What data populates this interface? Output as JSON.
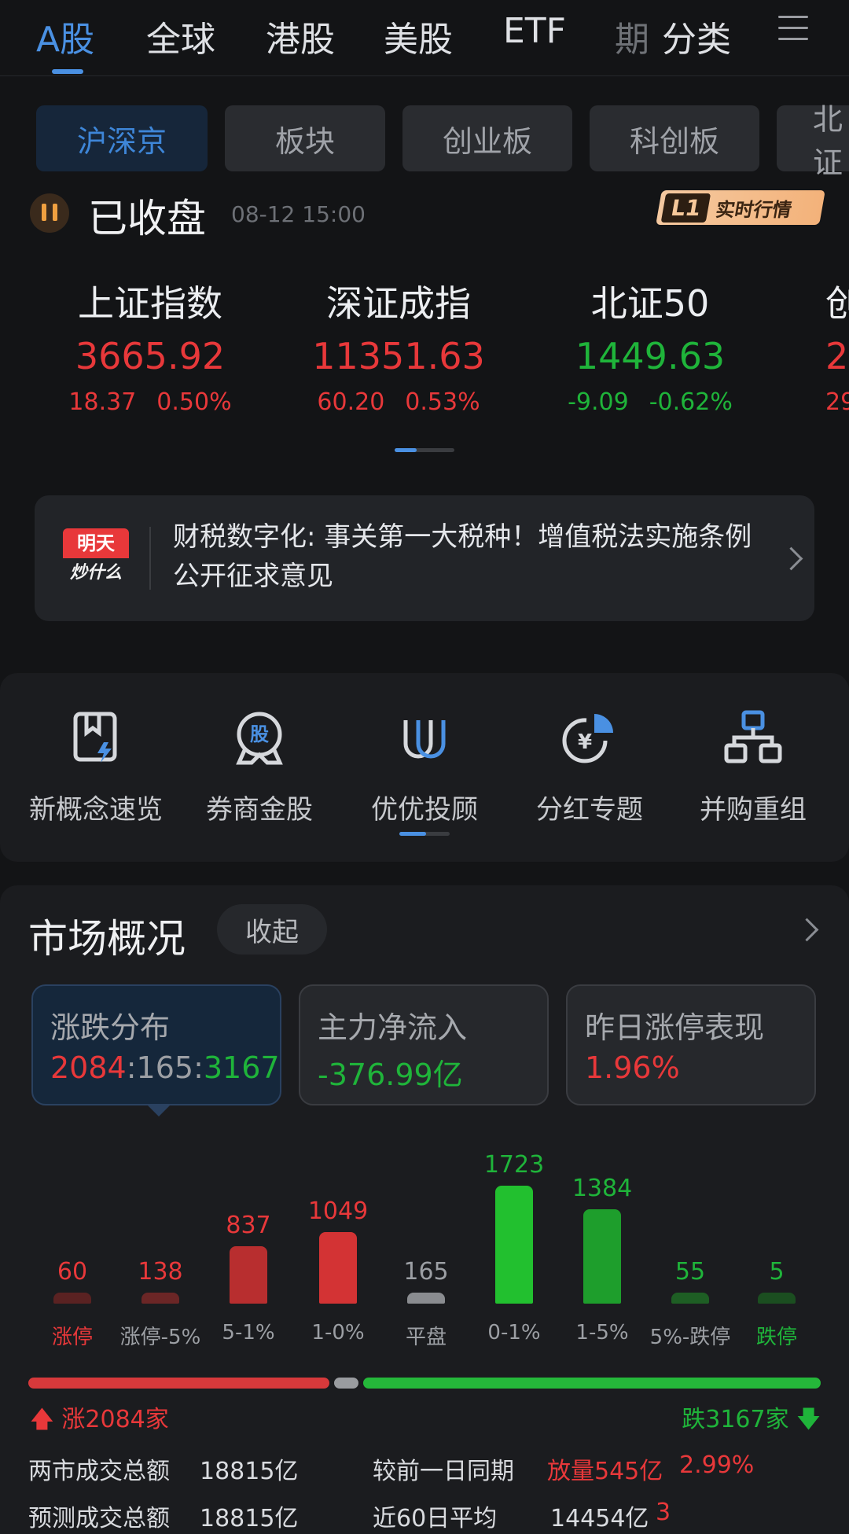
{
  "top_tabs": [
    "A股",
    "全球",
    "港股",
    "美股",
    "ETF",
    "期",
    "分类"
  ],
  "sub_tabs": [
    "沪深京",
    "板块",
    "创业板",
    "科创板",
    "北证"
  ],
  "status": {
    "title": "已收盘",
    "time": "08-12  15:00",
    "badge_l1": "L1",
    "badge_text": "实时行情"
  },
  "indices": [
    {
      "name": "上证指数",
      "value": "3665.92",
      "change": "18.37",
      "pct": "0.50%",
      "color": "#e8383a"
    },
    {
      "name": "深证成指",
      "value": "11351.63",
      "change": "60.20",
      "pct": "0.53%",
      "color": "#e8383a"
    },
    {
      "name": "北证50",
      "value": "1449.63",
      "change": "-9.09",
      "pct": "-0.62%",
      "color": "#1fb43a"
    },
    {
      "name": "创",
      "value": "2",
      "change": "29.",
      "pct": "",
      "color": "#e8383a"
    }
  ],
  "news": {
    "logo_top": "明天",
    "logo_bottom": "炒什么",
    "text": "财税数字化: 事关第一大税种！增值税法实施条例公开征求意见"
  },
  "shortcuts": [
    {
      "label": "新概念速览",
      "icon": "new-concept-icon"
    },
    {
      "label": "券商金股",
      "icon": "broker-gold-stock-icon"
    },
    {
      "label": "优优投顾",
      "icon": "advisor-icon"
    },
    {
      "label": "分红专题",
      "icon": "dividend-icon"
    },
    {
      "label": "并购重组",
      "icon": "merger-icon"
    }
  ],
  "market": {
    "title": "市场概况",
    "collapse_label": "收起",
    "cards": [
      {
        "label": "涨跌分布",
        "up": "2084",
        "flat": "165",
        "down": "3167"
      },
      {
        "label": "主力净流入",
        "value": "-376.99亿"
      },
      {
        "label": "昨日涨停表现",
        "value": "1.96%"
      }
    ],
    "up_label": "涨2084家",
    "down_label": "跌3167家",
    "up_count": 2084,
    "flat_count": 165,
    "down_count": 3167
  },
  "chart_data": {
    "type": "bar",
    "categories": [
      "涨停",
      "涨停-5%",
      "5-1%",
      "1-0%",
      "平盘",
      "0-1%",
      "1-5%",
      "5%-跌停",
      "跌停"
    ],
    "values": [
      60,
      138,
      837,
      1049,
      165,
      1723,
      1384,
      55,
      5
    ],
    "colors": [
      "#e8383a",
      "#e8383a",
      "#e8383a",
      "#e8383a",
      "#8a8c90",
      "#1fb43a",
      "#1fb43a",
      "#1fb43a",
      "#1fb43a"
    ],
    "bar_colors": [
      "#5a2222",
      "#6b2626",
      "#b82e2f",
      "#d33334",
      "#8a8c90",
      "#22c02f",
      "#1e9e2c",
      "#1e5e24",
      "#1b4e20"
    ],
    "label_colors": [
      "#e8383a",
      "#e8383a",
      "#e8383a",
      "#e8383a",
      "#9c9fa4",
      "#1fb43a",
      "#1fb43a",
      "#1fb43a",
      "#1fb43a"
    ],
    "title": "",
    "ylim": [
      0,
      1723
    ]
  },
  "stats": {
    "total_label": "两市成交总额",
    "total_value": "18815亿",
    "compare_label": "较前一日同期",
    "compare_value": "放量545亿",
    "compare_pct": "2.99%",
    "forecast_label": "预测成交总额",
    "forecast_value": "18815亿",
    "avg60_label": "近60日平均",
    "avg60_value": "14454亿",
    "avg60_extra": "3"
  }
}
